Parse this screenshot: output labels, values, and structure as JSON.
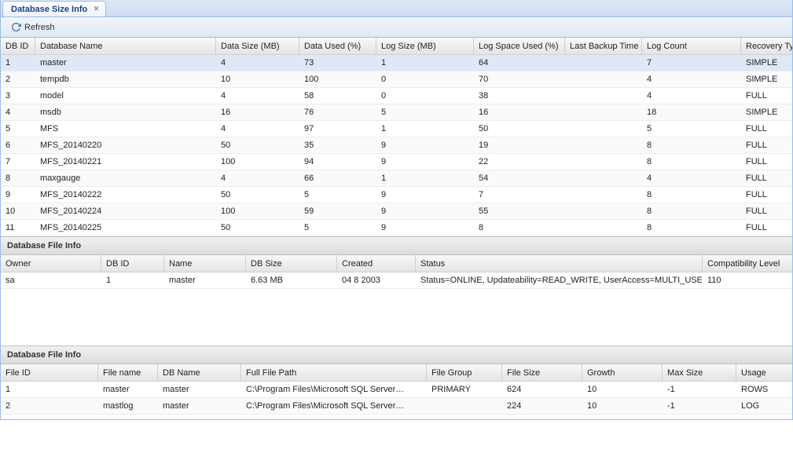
{
  "tab": {
    "title": "Database Size Info"
  },
  "toolbar": {
    "refresh_label": "Refresh"
  },
  "gridA": {
    "headers": [
      "DB ID",
      "Database Name",
      "Data Size (MB)",
      "Data Used (%)",
      "Log Size (MB)",
      "Log Space Used (%)",
      "Last Backup Time",
      "Log Count",
      "Recovery Type"
    ],
    "selected": 0,
    "rows": [
      {
        "db_id": "1",
        "name": "master",
        "data_size": "4",
        "data_used": "73",
        "log_size": "1",
        "log_used": "64",
        "last_backup": "",
        "log_count": "7",
        "recovery": "SIMPLE"
      },
      {
        "db_id": "2",
        "name": "tempdb",
        "data_size": "10",
        "data_used": "100",
        "log_size": "0",
        "log_used": "70",
        "last_backup": "",
        "log_count": "4",
        "recovery": "SIMPLE"
      },
      {
        "db_id": "3",
        "name": "model",
        "data_size": "4",
        "data_used": "58",
        "log_size": "0",
        "log_used": "38",
        "last_backup": "",
        "log_count": "4",
        "recovery": "FULL"
      },
      {
        "db_id": "4",
        "name": "msdb",
        "data_size": "16",
        "data_used": "76",
        "log_size": "5",
        "log_used": "16",
        "last_backup": "",
        "log_count": "18",
        "recovery": "SIMPLE"
      },
      {
        "db_id": "5",
        "name": "MFS",
        "data_size": "4",
        "data_used": "97",
        "log_size": "1",
        "log_used": "50",
        "last_backup": "",
        "log_count": "5",
        "recovery": "FULL"
      },
      {
        "db_id": "6",
        "name": "MFS_20140220",
        "data_size": "50",
        "data_used": "35",
        "log_size": "9",
        "log_used": "19",
        "last_backup": "",
        "log_count": "8",
        "recovery": "FULL"
      },
      {
        "db_id": "7",
        "name": "MFS_20140221",
        "data_size": "100",
        "data_used": "94",
        "log_size": "9",
        "log_used": "22",
        "last_backup": "",
        "log_count": "8",
        "recovery": "FULL"
      },
      {
        "db_id": "8",
        "name": "maxgauge",
        "data_size": "4",
        "data_used": "66",
        "log_size": "1",
        "log_used": "54",
        "last_backup": "",
        "log_count": "4",
        "recovery": "FULL"
      },
      {
        "db_id": "9",
        "name": "MFS_20140222",
        "data_size": "50",
        "data_used": "5",
        "log_size": "9",
        "log_used": "7",
        "last_backup": "",
        "log_count": "8",
        "recovery": "FULL"
      },
      {
        "db_id": "10",
        "name": "MFS_20140224",
        "data_size": "100",
        "data_used": "59",
        "log_size": "9",
        "log_used": "55",
        "last_backup": "",
        "log_count": "8",
        "recovery": "FULL"
      },
      {
        "db_id": "11",
        "name": "MFS_20140225",
        "data_size": "50",
        "data_used": "5",
        "log_size": "9",
        "log_used": "8",
        "last_backup": "",
        "log_count": "8",
        "recovery": "FULL"
      }
    ]
  },
  "panelB": {
    "title": "Database File Info"
  },
  "gridB": {
    "headers": [
      "Owner",
      "DB ID",
      "Name",
      "DB Size",
      "Created",
      "Status",
      "Compatibility Level"
    ],
    "rows": [
      {
        "owner": "sa",
        "db_id": "1",
        "name": "master",
        "db_size": "6.63 MB",
        "created": "04 8 2003",
        "status": "Status=ONLINE, Updateability=READ_WRITE, UserAccess=MULTI_USER…",
        "compat": "110"
      }
    ]
  },
  "panelC": {
    "title": "Database File Info"
  },
  "gridC": {
    "headers": [
      "File ID",
      "File name",
      "DB Name",
      "Full File Path",
      "File Group",
      "File Size",
      "Growth",
      "Max Size",
      "Usage"
    ],
    "rows": [
      {
        "file_id": "1",
        "file_name": "master",
        "db_name": "master",
        "path": "C:\\Program Files\\Microsoft SQL Server…",
        "file_group": "PRIMARY",
        "file_size": "624",
        "growth": "10",
        "max_size": "-1",
        "usage": "ROWS"
      },
      {
        "file_id": "2",
        "file_name": "mastlog",
        "db_name": "master",
        "path": "C:\\Program Files\\Microsoft SQL Server…",
        "file_group": "",
        "file_size": "224",
        "growth": "10",
        "max_size": "-1",
        "usage": "LOG"
      }
    ]
  }
}
